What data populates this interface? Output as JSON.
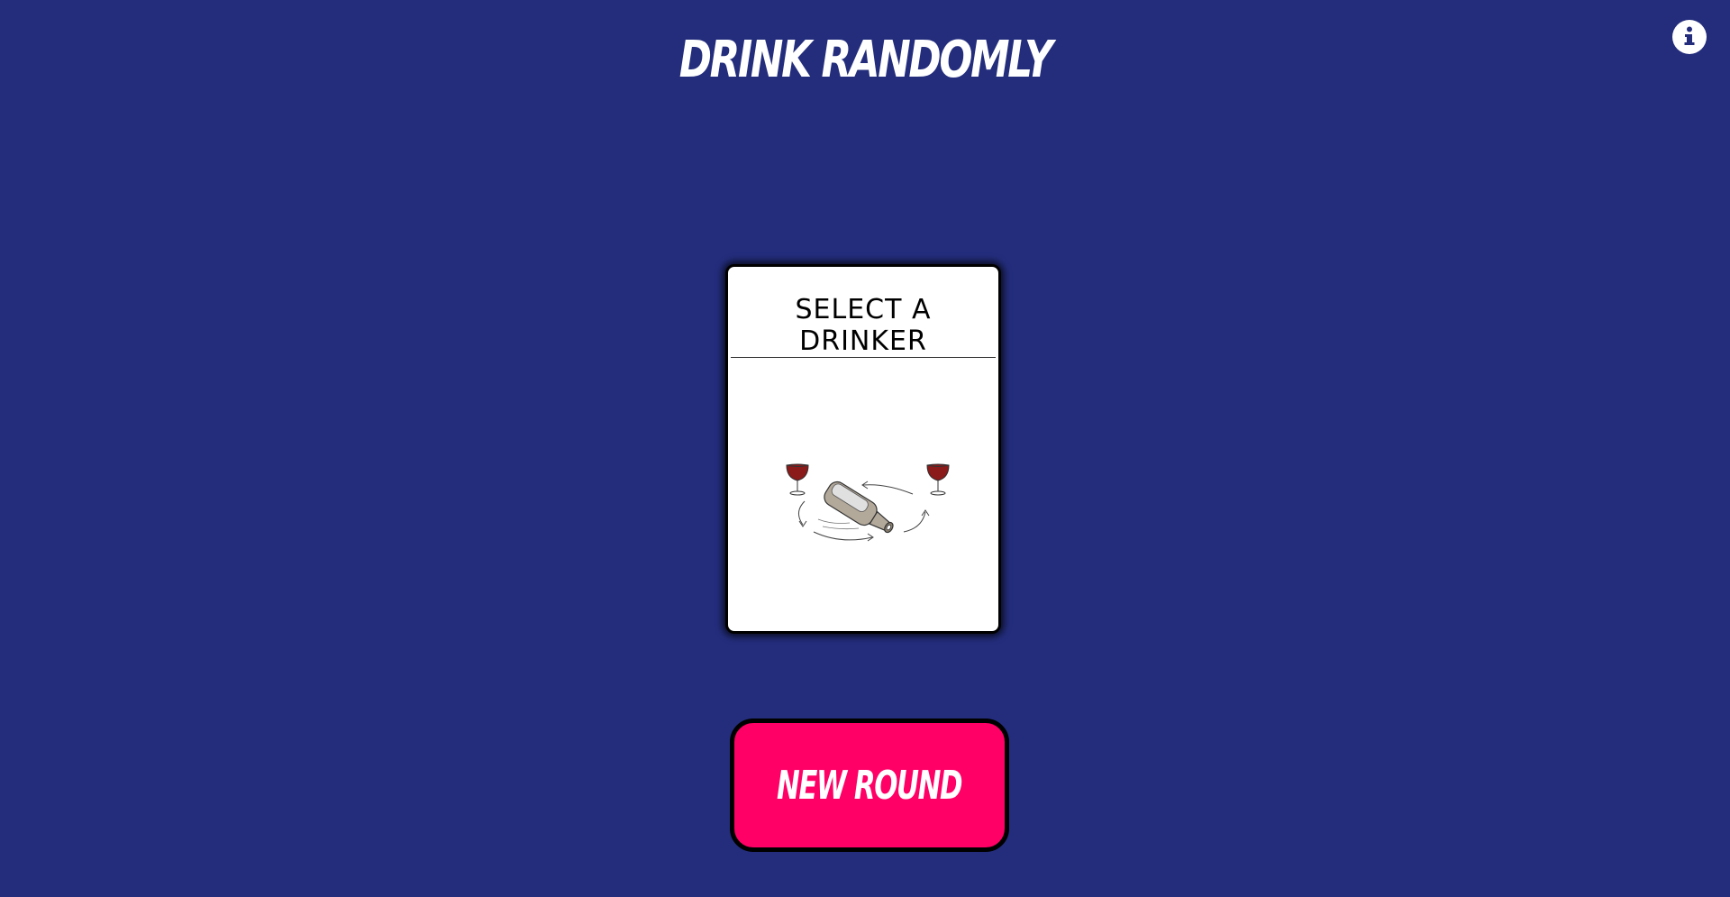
{
  "header": {
    "title": "DRINK RANDOMLY",
    "info_icon": "info-icon"
  },
  "card": {
    "title": "SELECT A DRINKER",
    "illustration_icon": "spinning-bottle-icon"
  },
  "actions": {
    "new_round_label": "NEW ROUND"
  },
  "colors": {
    "background": "#232d7c",
    "button": "#ff0066",
    "text_light": "#ffffff",
    "card": "#ffffff"
  }
}
